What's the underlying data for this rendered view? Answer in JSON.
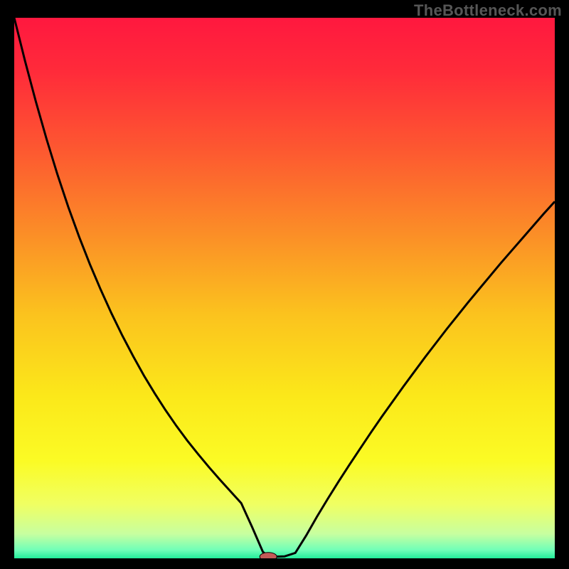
{
  "watermark": "TheBottleneck.com",
  "colors": {
    "bg": "#000000",
    "gradient_stops": [
      {
        "offset": 0.0,
        "color": "#ff183f"
      },
      {
        "offset": 0.1,
        "color": "#ff2b3a"
      },
      {
        "offset": 0.25,
        "color": "#fd5a30"
      },
      {
        "offset": 0.4,
        "color": "#fb8e27"
      },
      {
        "offset": 0.55,
        "color": "#fbc31e"
      },
      {
        "offset": 0.7,
        "color": "#fbe81a"
      },
      {
        "offset": 0.82,
        "color": "#fbfb25"
      },
      {
        "offset": 0.9,
        "color": "#f0ff62"
      },
      {
        "offset": 0.955,
        "color": "#c7ffa0"
      },
      {
        "offset": 0.985,
        "color": "#6fffb8"
      },
      {
        "offset": 1.0,
        "color": "#22ee9b"
      }
    ],
    "curve": "#000000",
    "marker_fill": "#c45a58",
    "marker_stroke": "#000000"
  },
  "chart_data": {
    "type": "line",
    "title": "",
    "xlabel": "",
    "ylabel": "",
    "xlim": [
      0,
      100
    ],
    "ylim": [
      0,
      100
    ],
    "grid": false,
    "legend": false,
    "x": [
      0,
      2,
      4,
      6,
      8,
      10,
      12,
      14,
      16,
      18,
      20,
      22,
      24,
      26,
      28,
      30,
      32,
      34,
      36,
      38,
      40,
      42,
      43,
      44,
      45,
      46,
      47,
      48,
      50,
      52,
      54,
      56,
      58,
      60,
      62,
      64,
      66,
      68,
      70,
      72,
      74,
      76,
      78,
      80,
      82,
      84,
      86,
      88,
      90,
      92,
      94,
      96,
      98,
      100
    ],
    "y": [
      100,
      92,
      84.5,
      77.5,
      71,
      65,
      59.5,
      54.4,
      49.7,
      45.3,
      41.2,
      37.4,
      33.8,
      30.5,
      27.4,
      24.5,
      21.8,
      19.3,
      16.9,
      14.6,
      12.4,
      10.2,
      8,
      5.8,
      3.5,
      1.2,
      0.4,
      0.3,
      0.36,
      1.0,
      4.2,
      7.7,
      11.0,
      14.2,
      17.3,
      20.3,
      23.3,
      26.2,
      29.0,
      31.8,
      34.5,
      37.2,
      39.8,
      42.4,
      44.9,
      47.4,
      49.8,
      52.2,
      54.6,
      56.9,
      59.2,
      61.5,
      63.8,
      66.0
    ],
    "marker": {
      "x": 47,
      "y": 0.3,
      "rx": 12,
      "ry": 6
    },
    "annotations": []
  }
}
